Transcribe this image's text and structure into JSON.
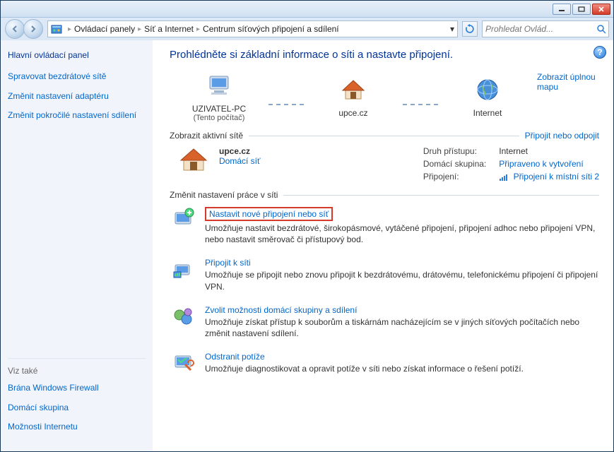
{
  "breadcrumb": {
    "root": "Ovládací panely",
    "mid": "Síť a Internet",
    "leaf": "Centrum síťových připojení a sdílení"
  },
  "search": {
    "placeholder": "Prohledat Ovlád..."
  },
  "sidebar": {
    "title": "Hlavní ovládací panel",
    "links": {
      "l0": "Spravovat bezdrátové sítě",
      "l1": "Změnit nastavení adaptéru",
      "l2": "Změnit pokročilé nastavení sdílení"
    },
    "seealso_title": "Viz také",
    "seealso": {
      "s0": "Brána Windows Firewall",
      "s1": "Domácí skupina",
      "s2": "Možnosti Internetu"
    }
  },
  "main": {
    "heading": "Prohlédněte si základní informace o síti a nastavte připojení.",
    "full_map": "Zobrazit úplnou mapu",
    "topology": {
      "pc": "UZIVATEL-PC",
      "pc_sub": "(Tento počítač)",
      "gw": "upce.cz",
      "net": "Internet"
    },
    "active_title": "Zobrazit aktivní sítě",
    "active_action": "Připojit nebo odpojit",
    "network": {
      "name": "upce.cz",
      "type": "Domácí síť",
      "props": {
        "access_k": "Druh přístupu:",
        "access_v": "Internet",
        "hg_k": "Domácí skupina:",
        "hg_v": "Připraveno k vytvoření",
        "conn_k": "Připojení:",
        "conn_v": "Připojení k místní síti 2"
      }
    },
    "change_title": "Změnit nastavení práce v síti",
    "tasks": {
      "t0": {
        "title": "Nastavit nové připojení nebo síť",
        "desc": "Umožňuje nastavit bezdrátové, širokopásmové, vytáčené připojení, připojení adhoc nebo připojení VPN, nebo nastavit směrovač či přístupový bod."
      },
      "t1": {
        "title": "Připojit k síti",
        "desc": "Umožňuje se připojit nebo znovu připojit k bezdrátovému, drátovému, telefonickému připojení či připojení VPN."
      },
      "t2": {
        "title": "Zvolit možnosti domácí skupiny a sdílení",
        "desc": "Umožňuje získat přístup k souborům a tiskárnám nacházejícím se v jiných síťových počítačích nebo změnit nastavení sdílení."
      },
      "t3": {
        "title": "Odstranit potíže",
        "desc": "Umožňuje diagnostikovat a opravit potíže v síti nebo získat informace o řešení potíží."
      }
    }
  }
}
